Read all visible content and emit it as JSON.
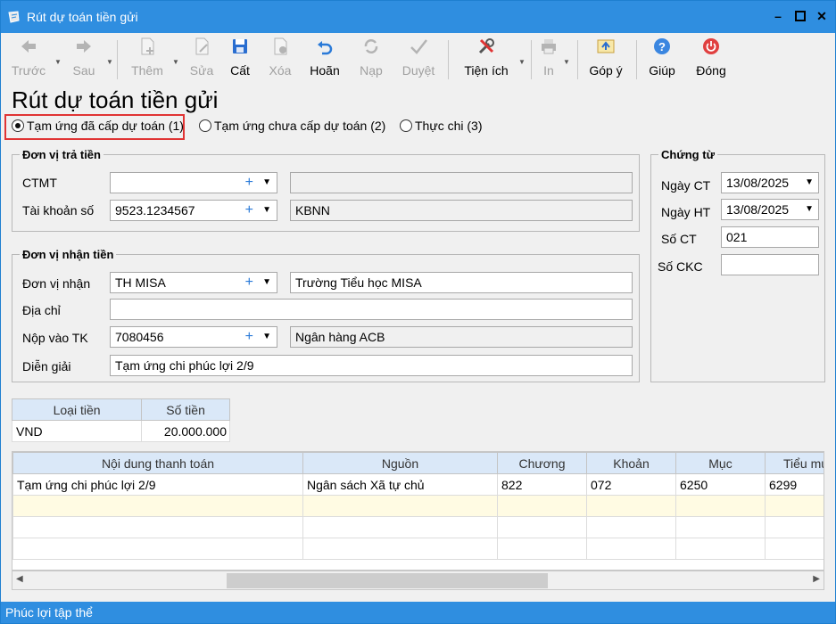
{
  "window": {
    "title": "Rút dự toán tiền gửi"
  },
  "toolbar": {
    "prev": "Trước",
    "next": "Sau",
    "add": "Thêm",
    "edit": "Sửa",
    "save": "Cất",
    "delete": "Xóa",
    "undo": "Hoãn",
    "load": "Nạp",
    "approve": "Duyệt",
    "utilities": "Tiện ích",
    "print": "In",
    "feedback": "Góp ý",
    "help": "Giúp",
    "close": "Đóng"
  },
  "page_title": "Rút dự toán tiền gửi",
  "radios": [
    {
      "label": "Tạm ứng đã cấp dự toán (1)",
      "checked": true
    },
    {
      "label": "Tạm ứng chưa cấp dự toán (2)",
      "checked": false
    },
    {
      "label": "Thực chi (3)",
      "checked": false
    }
  ],
  "payer": {
    "title": "Đơn vị trả tiền",
    "ctmt_label": "CTMT",
    "ctmt_value": "",
    "ctmt_desc": "",
    "account_label": "Tài khoản số",
    "account_value": "9523.1234567",
    "account_desc": "KBNN"
  },
  "payee": {
    "title": "Đơn vị nhận tiền",
    "unit_label": "Đơn vị nhận",
    "unit_value": "TH MISA",
    "unit_desc": "Trường Tiểu học MISA",
    "address_label": "Địa chỉ",
    "address_value": "",
    "account_label": "Nộp vào TK",
    "account_value": "7080456",
    "account_desc": "Ngân hàng ACB",
    "memo_label": "Diễn giải",
    "memo_value": "Tạm ứng chi phúc lợi 2/9"
  },
  "voucher": {
    "title": "Chứng từ",
    "date_ct_label": "Ngày CT",
    "date_ct": "13/08/2025",
    "date_ht_label": "Ngày HT",
    "date_ht": "13/08/2025",
    "no_ct_label": "Số CT",
    "no_ct": "021",
    "no_ckc_label": "Số CKC",
    "no_ckc": ""
  },
  "currency_table": {
    "headers": [
      "Loại tiền",
      "Số tiền"
    ],
    "row": [
      "VND",
      "20.000.000"
    ]
  },
  "detail_table": {
    "headers": [
      "Nội dung thanh toán",
      "Nguồn",
      "Chương",
      "Khoản",
      "Mục",
      "Tiểu mụ"
    ],
    "rows": [
      [
        "Tạm ứng chi phúc lợi 2/9",
        "Ngân sách Xã tự chủ",
        "822",
        "072",
        "6250",
        "6299"
      ]
    ]
  },
  "status": "Phúc lợi tập thể",
  "colors": {
    "accent": "#2f8ee0",
    "highlight": "#e03434",
    "header_bg": "#dae8f8",
    "new_row": "#fffbe3"
  }
}
